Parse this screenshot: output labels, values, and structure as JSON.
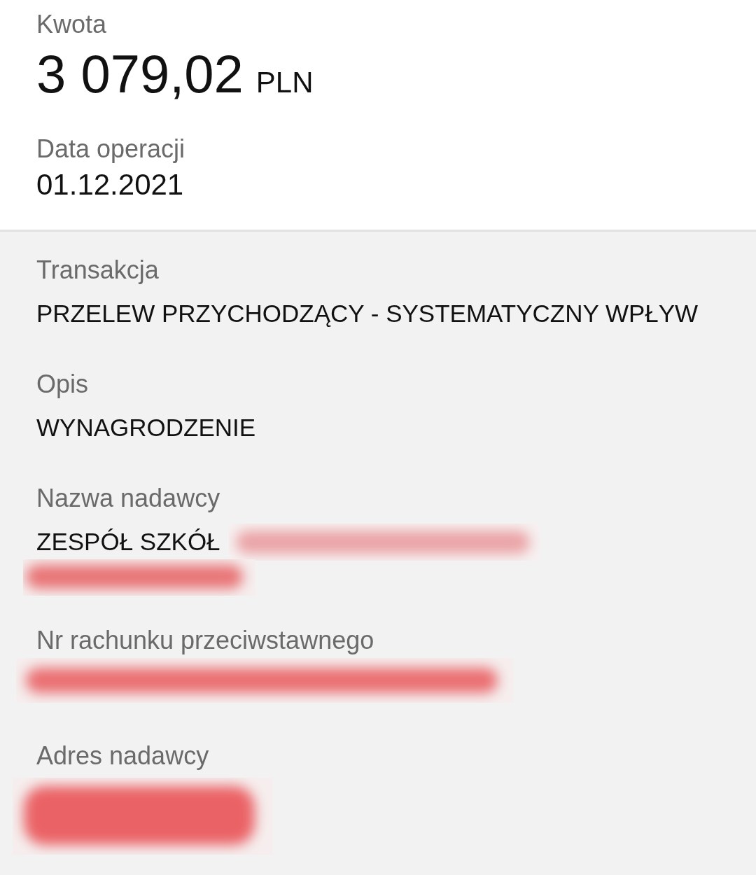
{
  "amount": {
    "label": "Kwota",
    "value": "3 079,02",
    "currency": "PLN"
  },
  "date": {
    "label": "Data operacji",
    "value": "01.12.2021"
  },
  "details": [
    {
      "label": "Transakcja",
      "value": "PRZELEW PRZYCHODZĄCY - SYSTEMATYCZNY WPŁYW"
    },
    {
      "label": "Opis",
      "value": "WYNAGRODZENIE"
    },
    {
      "label": "Nazwa nadawcy",
      "value": "ZESPÓŁ SZKÓŁ",
      "redactions": [
        {
          "kind": "inline"
        },
        {
          "kind": "line"
        }
      ]
    },
    {
      "label": "Nr rachunku przeciwstawnego",
      "redactions": [
        {
          "kind": "bar"
        }
      ]
    },
    {
      "label": "Adres nadawcy",
      "redactions": [
        {
          "kind": "block"
        }
      ]
    }
  ]
}
